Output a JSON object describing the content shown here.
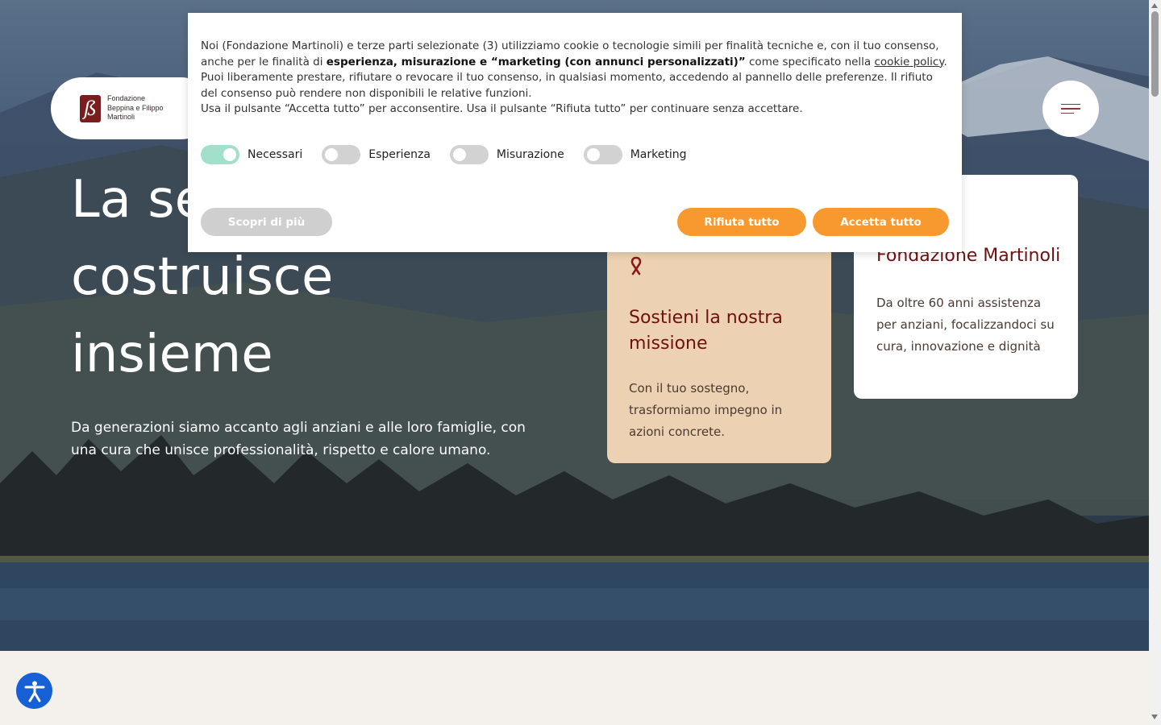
{
  "logo": {
    "mark": "ß",
    "lines": [
      "Fondazione",
      "Beppina e Filippo",
      "Martinoli"
    ]
  },
  "hero": {
    "headline": [
      "La se",
      "costruisce",
      "insieme"
    ],
    "subtitle": "Da generazioni siamo accanto agli anziani e alle loro famiglie, con una cura che unisce professionalità, rispetto e calore umano."
  },
  "cards": {
    "mission": {
      "icon": "ribbon-icon",
      "title": "Sostieni la nostra missione",
      "text": "Con il tuo sostegno, trasformiamo impegno in azioni concrete."
    },
    "fondazione": {
      "title": "Fondazione Martinoli",
      "text": "Da oltre 60 anni assistenza per anziani, focalizzandoci su cura, innovazione e dignità"
    }
  },
  "cookie": {
    "p1_a": "Noi (Fondazione Martinoli) e terze parti selezionate (3) utilizziamo cookie o tecnologie simili per finalità tecniche e, con il tuo consenso, anche per le finalità di ",
    "p1_bold": "esperienza, misurazione e “marketing (con annunci personalizzati)”",
    "p1_b": " come specificato nella ",
    "p1_link": "cookie policy",
    "p1_c": ".",
    "p2": "Puoi liberamente prestare, rifiutare o revocare il tuo consenso, in qualsiasi momento, accedendo al pannello delle preferenze. Il rifiuto del consenso può rendere non disponibili le relative funzioni.",
    "p3": "Usa il pulsante “Accetta tutto” per acconsentire. Usa il pulsante “Rifiuta tutto” per continuare senza accettare.",
    "toggles": [
      {
        "label": "Necessari",
        "on": true
      },
      {
        "label": "Esperienza",
        "on": false
      },
      {
        "label": "Misurazione",
        "on": false
      },
      {
        "label": "Marketing",
        "on": false
      }
    ],
    "buttons": {
      "more": "Scopri di più",
      "reject": "Rifiuta tutto",
      "accept": "Accetta tutto"
    }
  },
  "colors": {
    "brand": "#7a1d1d",
    "accent": "#f7992e",
    "toggle_on": "#a3e0cc",
    "mission_card": "#ecd2b2",
    "a11y": "#1660d6"
  }
}
